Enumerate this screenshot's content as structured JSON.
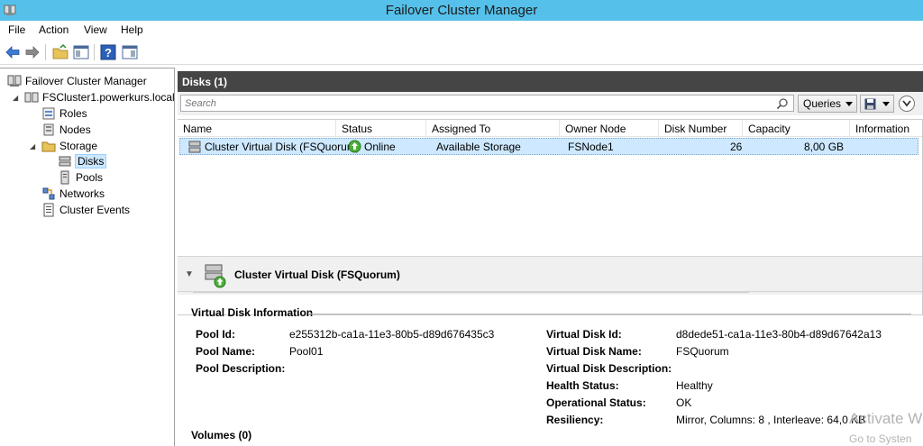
{
  "window": {
    "title": "Failover Cluster Manager"
  },
  "menu": [
    "File",
    "Action",
    "View",
    "Help"
  ],
  "tree": {
    "root": "Failover Cluster Manager",
    "cluster": "FSCluster1.powerkurs.local",
    "roles": "Roles",
    "nodes": "Nodes",
    "storage": "Storage",
    "disks": "Disks",
    "pools": "Pools",
    "networks": "Networks",
    "events": "Cluster Events"
  },
  "panel": {
    "title": "Disks (1)",
    "search_placeholder": "Search",
    "queries_label": "Queries"
  },
  "grid": {
    "columns": [
      "Name",
      "Status",
      "Assigned To",
      "Owner Node",
      "Disk Number",
      "Capacity",
      "Information"
    ],
    "rows": [
      {
        "name": "Cluster Virtual Disk (FSQuorum)",
        "status": "Online",
        "assigned_to": "Available Storage",
        "owner_node": "FSNode1",
        "disk_number": "26",
        "capacity": "8,00 GB",
        "information": ""
      }
    ]
  },
  "details": {
    "title": "Cluster Virtual Disk (FSQuorum)",
    "section_title": "Virtual Disk Information",
    "left": {
      "pool_id_label": "Pool Id:",
      "pool_id": "e255312b-ca1a-11e3-80b5-d89d676435c3",
      "pool_name_label": "Pool Name:",
      "pool_name": "Pool01",
      "pool_desc_label": "Pool Description:"
    },
    "right": {
      "vdisk_id_label": "Virtual Disk Id:",
      "vdisk_id": "d8dede51-ca1a-11e3-80b4-d89d67642a13",
      "vdisk_name_label": "Virtual Disk Name:",
      "vdisk_name": "FSQuorum",
      "vdisk_desc_label": "Virtual Disk Description:",
      "health_label": "Health Status:",
      "health": "Healthy",
      "op_label": "Operational Status:",
      "op": "OK",
      "resiliency_label": "Resiliency:",
      "resiliency": "Mirror, Columns: 8 , Interleave: 64,0 KB"
    },
    "volumes_title": "Volumes (0)"
  },
  "watermark": {
    "line1": "Activate W",
    "line2": "Go to Systen"
  },
  "colors": {
    "titlebar": "#55c0e9",
    "panel_header": "#454545",
    "selection": "#cde8ff"
  }
}
